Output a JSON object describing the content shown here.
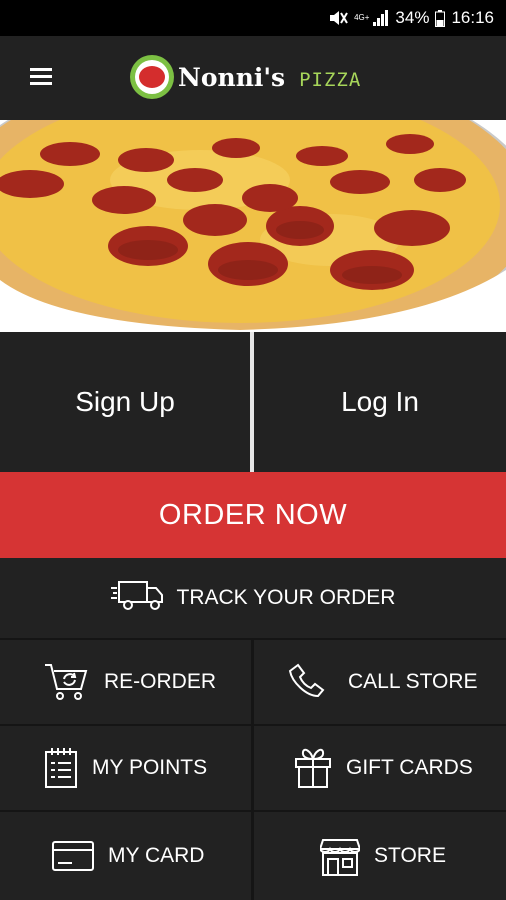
{
  "status_bar": {
    "network": "4G+",
    "battery": "34%",
    "time": "16:16"
  },
  "app_bar": {
    "brand_name": "Nonni's",
    "brand_sub": "PIZZA"
  },
  "auth": {
    "sign_up": "Sign Up",
    "log_in": "Log In"
  },
  "order_now": "ORDER NOW",
  "track_order": "TRACK YOUR ORDER",
  "menu": {
    "reorder": "RE-ORDER",
    "call_store": "CALL STORE",
    "my_points": "MY POINTS",
    "gift_cards": "GIFT CARDS",
    "my_card": "MY CARD",
    "store": "STORE"
  },
  "colors": {
    "accent_red": "#d63434",
    "brand_green": "#a7d65a",
    "background": "#222222"
  }
}
